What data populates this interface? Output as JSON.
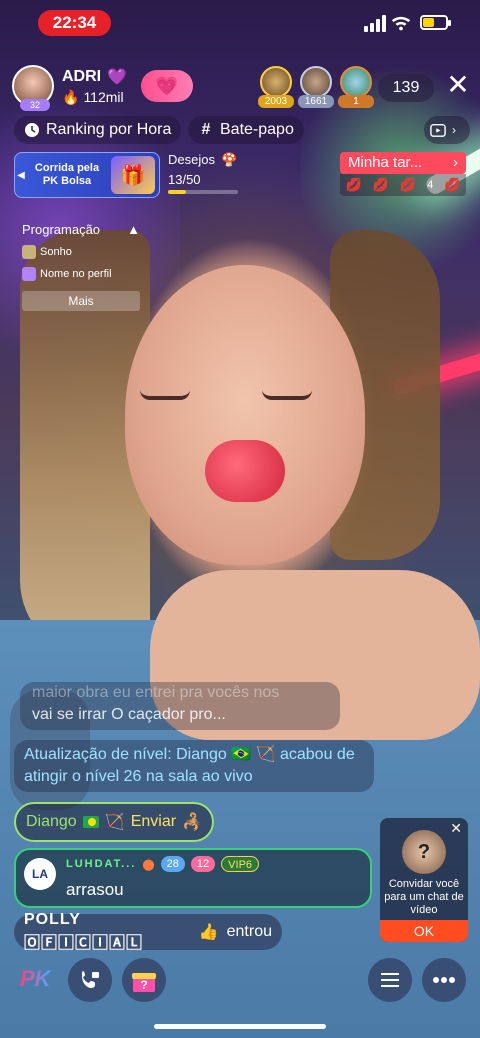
{
  "status": {
    "time": "22:34"
  },
  "host": {
    "name": "ADRI",
    "level": "32",
    "likes": "112mil"
  },
  "viewers": {
    "top": [
      {
        "count": "2003"
      },
      {
        "count": "1661"
      },
      {
        "count": "1"
      }
    ],
    "total": "139"
  },
  "nav": {
    "ranking": "Ranking por Hora",
    "chat": "Bate-papo"
  },
  "pk_banner": {
    "title": "Corrida pela PK Bolsa"
  },
  "wishes": {
    "label": "Desejos",
    "value": "13/50",
    "progress": 0.26
  },
  "task": {
    "label": "Minha tar...",
    "count": "4"
  },
  "schedule": {
    "title": "Programação",
    "items": [
      "Sonho",
      "Nome no perfil"
    ],
    "more": "Mais"
  },
  "chat": {
    "faded_line1": "maior obra eu entrei pra vocês nos",
    "faded_line2": "vai se irrar O caçador pro...",
    "level_update": "Atualização de nível: Diango 🇧🇷 🏹 acabou de atingir o nível 26 na sala ao vivo",
    "send_user": "Diango",
    "send_action": "Enviar",
    "rich": {
      "avatar": "LA",
      "username": "LUHDAT...",
      "badge1": "28",
      "badge2": "12",
      "vip": "VIP6",
      "text": "arrasou"
    },
    "join_user": "POLLY 🄾🄵🄸🄲🄸🄰🄻",
    "join_action": "entrou"
  },
  "invite": {
    "text": "Convidar você para um chat de vídeo",
    "ok": "OK"
  },
  "bottom": {
    "pk": "PK"
  },
  "colors": {
    "accent": "#ff4a5e",
    "level_text": "#9fe3ff",
    "send_border": "#9be36d"
  }
}
